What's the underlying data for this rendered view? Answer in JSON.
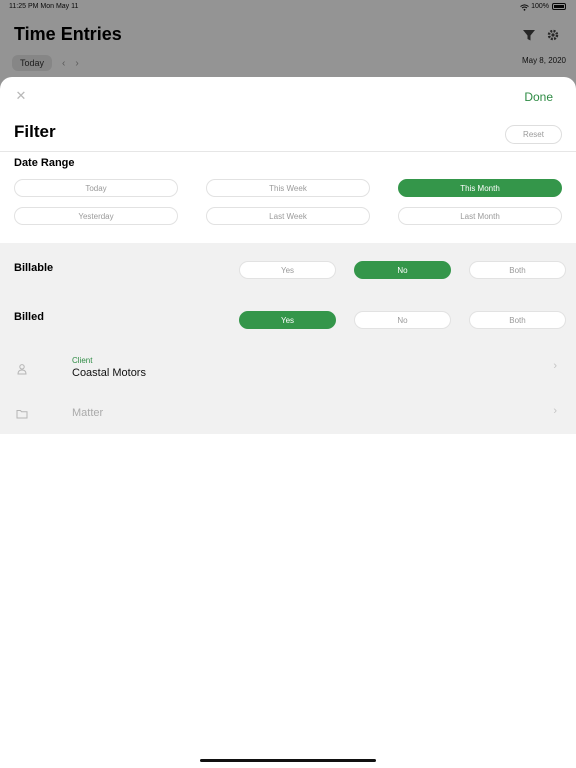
{
  "status_bar": {
    "time_date": "11:25 PM   Mon May 11",
    "battery": "100%"
  },
  "background": {
    "title": "Time Entries",
    "today_label": "Today",
    "date": "May 8, 2020"
  },
  "sheet": {
    "done_label": "Done",
    "title": "Filter",
    "reset_label": "Reset",
    "date_range": {
      "label": "Date Range",
      "options": [
        "Today",
        "This Week",
        "This Month",
        "Yesterday",
        "Last Week",
        "Last Month"
      ],
      "selected": "This Month"
    },
    "billable": {
      "label": "Billable",
      "options": [
        "Yes",
        "No",
        "Both"
      ],
      "selected": "No"
    },
    "billed": {
      "label": "Billed",
      "options": [
        "Yes",
        "No",
        "Both"
      ],
      "selected": "Yes"
    },
    "client": {
      "caption": "Client",
      "value": "Coastal Motors"
    },
    "matter": {
      "label": "Matter"
    }
  },
  "colors": {
    "accent": "#34964a",
    "accent_text": "#2e8b44"
  }
}
